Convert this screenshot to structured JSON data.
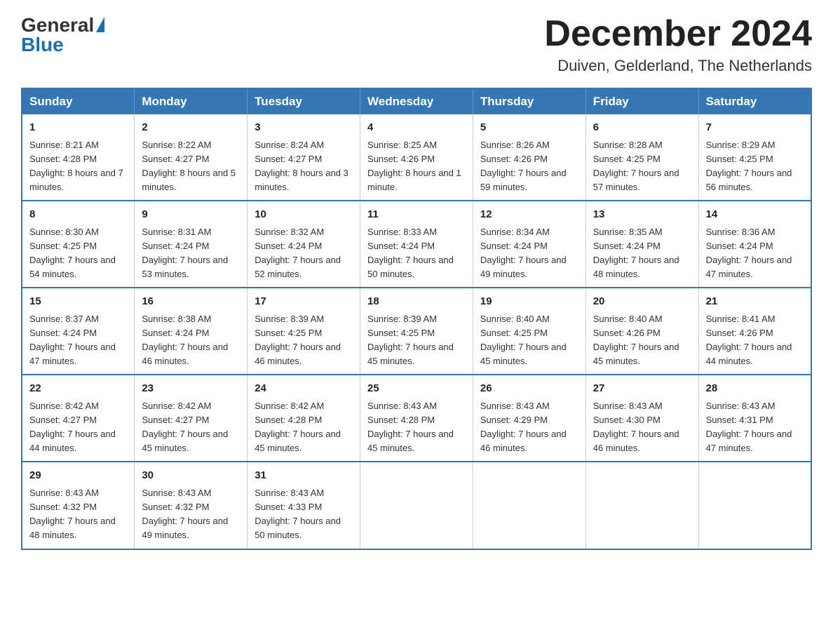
{
  "header": {
    "logo_general": "General",
    "logo_blue": "Blue",
    "month_title": "December 2024",
    "location": "Duiven, Gelderland, The Netherlands"
  },
  "weekdays": [
    "Sunday",
    "Monday",
    "Tuesday",
    "Wednesday",
    "Thursday",
    "Friday",
    "Saturday"
  ],
  "weeks": [
    [
      {
        "day": "1",
        "sunrise": "8:21 AM",
        "sunset": "4:28 PM",
        "daylight": "8 hours and 7 minutes."
      },
      {
        "day": "2",
        "sunrise": "8:22 AM",
        "sunset": "4:27 PM",
        "daylight": "8 hours and 5 minutes."
      },
      {
        "day": "3",
        "sunrise": "8:24 AM",
        "sunset": "4:27 PM",
        "daylight": "8 hours and 3 minutes."
      },
      {
        "day": "4",
        "sunrise": "8:25 AM",
        "sunset": "4:26 PM",
        "daylight": "8 hours and 1 minute."
      },
      {
        "day": "5",
        "sunrise": "8:26 AM",
        "sunset": "4:26 PM",
        "daylight": "7 hours and 59 minutes."
      },
      {
        "day": "6",
        "sunrise": "8:28 AM",
        "sunset": "4:25 PM",
        "daylight": "7 hours and 57 minutes."
      },
      {
        "day": "7",
        "sunrise": "8:29 AM",
        "sunset": "4:25 PM",
        "daylight": "7 hours and 56 minutes."
      }
    ],
    [
      {
        "day": "8",
        "sunrise": "8:30 AM",
        "sunset": "4:25 PM",
        "daylight": "7 hours and 54 minutes."
      },
      {
        "day": "9",
        "sunrise": "8:31 AM",
        "sunset": "4:24 PM",
        "daylight": "7 hours and 53 minutes."
      },
      {
        "day": "10",
        "sunrise": "8:32 AM",
        "sunset": "4:24 PM",
        "daylight": "7 hours and 52 minutes."
      },
      {
        "day": "11",
        "sunrise": "8:33 AM",
        "sunset": "4:24 PM",
        "daylight": "7 hours and 50 minutes."
      },
      {
        "day": "12",
        "sunrise": "8:34 AM",
        "sunset": "4:24 PM",
        "daylight": "7 hours and 49 minutes."
      },
      {
        "day": "13",
        "sunrise": "8:35 AM",
        "sunset": "4:24 PM",
        "daylight": "7 hours and 48 minutes."
      },
      {
        "day": "14",
        "sunrise": "8:36 AM",
        "sunset": "4:24 PM",
        "daylight": "7 hours and 47 minutes."
      }
    ],
    [
      {
        "day": "15",
        "sunrise": "8:37 AM",
        "sunset": "4:24 PM",
        "daylight": "7 hours and 47 minutes."
      },
      {
        "day": "16",
        "sunrise": "8:38 AM",
        "sunset": "4:24 PM",
        "daylight": "7 hours and 46 minutes."
      },
      {
        "day": "17",
        "sunrise": "8:39 AM",
        "sunset": "4:25 PM",
        "daylight": "7 hours and 46 minutes."
      },
      {
        "day": "18",
        "sunrise": "8:39 AM",
        "sunset": "4:25 PM",
        "daylight": "7 hours and 45 minutes."
      },
      {
        "day": "19",
        "sunrise": "8:40 AM",
        "sunset": "4:25 PM",
        "daylight": "7 hours and 45 minutes."
      },
      {
        "day": "20",
        "sunrise": "8:40 AM",
        "sunset": "4:26 PM",
        "daylight": "7 hours and 45 minutes."
      },
      {
        "day": "21",
        "sunrise": "8:41 AM",
        "sunset": "4:26 PM",
        "daylight": "7 hours and 44 minutes."
      }
    ],
    [
      {
        "day": "22",
        "sunrise": "8:42 AM",
        "sunset": "4:27 PM",
        "daylight": "7 hours and 44 minutes."
      },
      {
        "day": "23",
        "sunrise": "8:42 AM",
        "sunset": "4:27 PM",
        "daylight": "7 hours and 45 minutes."
      },
      {
        "day": "24",
        "sunrise": "8:42 AM",
        "sunset": "4:28 PM",
        "daylight": "7 hours and 45 minutes."
      },
      {
        "day": "25",
        "sunrise": "8:43 AM",
        "sunset": "4:28 PM",
        "daylight": "7 hours and 45 minutes."
      },
      {
        "day": "26",
        "sunrise": "8:43 AM",
        "sunset": "4:29 PM",
        "daylight": "7 hours and 46 minutes."
      },
      {
        "day": "27",
        "sunrise": "8:43 AM",
        "sunset": "4:30 PM",
        "daylight": "7 hours and 46 minutes."
      },
      {
        "day": "28",
        "sunrise": "8:43 AM",
        "sunset": "4:31 PM",
        "daylight": "7 hours and 47 minutes."
      }
    ],
    [
      {
        "day": "29",
        "sunrise": "8:43 AM",
        "sunset": "4:32 PM",
        "daylight": "7 hours and 48 minutes."
      },
      {
        "day": "30",
        "sunrise": "8:43 AM",
        "sunset": "4:32 PM",
        "daylight": "7 hours and 49 minutes."
      },
      {
        "day": "31",
        "sunrise": "8:43 AM",
        "sunset": "4:33 PM",
        "daylight": "7 hours and 50 minutes."
      },
      null,
      null,
      null,
      null
    ]
  ]
}
